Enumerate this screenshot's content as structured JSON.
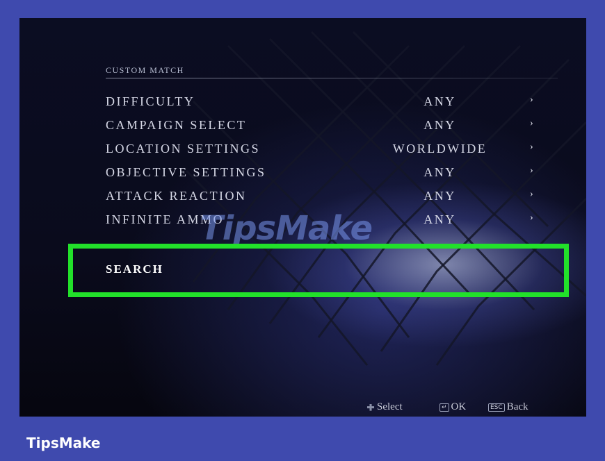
{
  "menu": {
    "title": "CUSTOM MATCH",
    "rows": [
      {
        "label": "DIFFICULTY",
        "value": "ANY"
      },
      {
        "label": "CAMPAIGN SELECT",
        "value": "ANY"
      },
      {
        "label": "LOCATION SETTINGS",
        "value": "WORLDWIDE"
      },
      {
        "label": "OBJECTIVE SETTINGS",
        "value": "ANY"
      },
      {
        "label": "ATTACK REACTION",
        "value": "ANY"
      },
      {
        "label": "INFINITE AMMO",
        "value": "ANY"
      }
    ],
    "arrow_glyph": "›",
    "search_label": "SEARCH"
  },
  "footer": {
    "select_label": "Select",
    "ok_key": "↵",
    "ok_label": "OK",
    "back_key": "ESC",
    "back_label": "Back"
  },
  "watermark": "TipsMake",
  "brand": "TipsMake",
  "colors": {
    "page_bg": "#3f4aae",
    "highlight": "#22e12a"
  }
}
